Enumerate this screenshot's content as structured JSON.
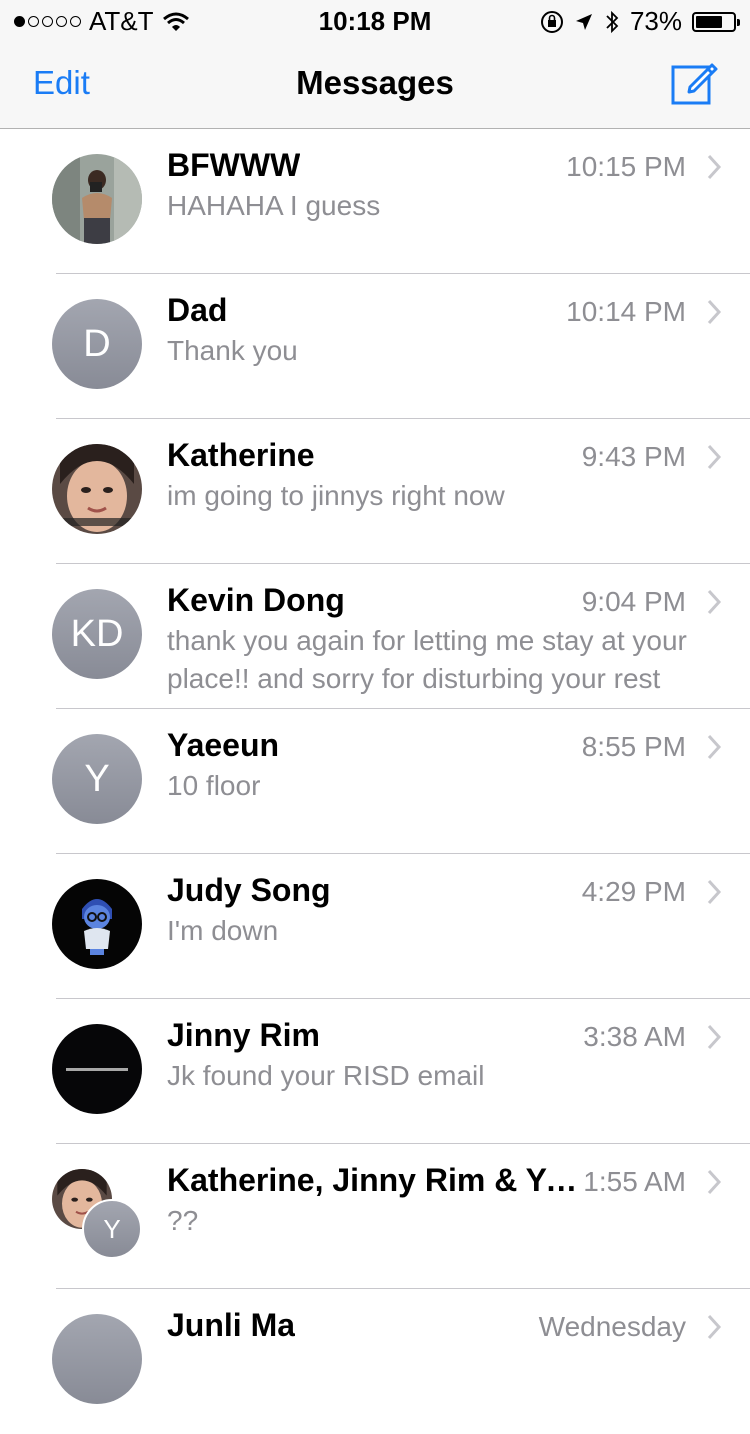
{
  "status_bar": {
    "carrier": "AT&T",
    "time": "10:18 PM",
    "battery_percent": "73%",
    "battery_level": 0.73,
    "icons": [
      "signal-dots-icon",
      "wifi-icon",
      "rotation-lock-icon",
      "location-arrow-icon",
      "bluetooth-icon",
      "battery-icon"
    ]
  },
  "nav": {
    "edit_label": "Edit",
    "title": "Messages",
    "compose_icon": "compose-icon"
  },
  "accent_color": "#1a7cf5",
  "conversations": [
    {
      "name": "BFWWW",
      "time": "10:15 PM",
      "preview": "HAHAHA I guess",
      "avatar": "photo"
    },
    {
      "name": "Dad",
      "time": "10:14 PM",
      "preview": "Thank you",
      "initials": "D"
    },
    {
      "name": "Katherine",
      "time": "9:43 PM",
      "preview": "im going to jinnys right now",
      "avatar": "photo"
    },
    {
      "name": "Kevin Dong",
      "time": "9:04 PM",
      "preview": "thank you again for letting me stay at your place!! and sorry for disturbing your rest",
      "initials": "KD"
    },
    {
      "name": "Yaeeun",
      "time": "8:55 PM",
      "preview": "10 floor",
      "initials": "Y"
    },
    {
      "name": "Judy Song",
      "time": "4:29 PM",
      "preview": "I'm down",
      "avatar": "photo"
    },
    {
      "name": "Jinny Rim",
      "time": "3:38 AM",
      "preview": "Jk found your RISD email",
      "avatar": "photo"
    },
    {
      "name": "Katherine, Jinny Rim & Ya...",
      "time": "1:55 AM",
      "preview": "??",
      "initials": "Y",
      "avatar": "group"
    },
    {
      "name": "Junli Ma",
      "time": "Wednesday",
      "preview": "",
      "avatar": "initials"
    }
  ]
}
